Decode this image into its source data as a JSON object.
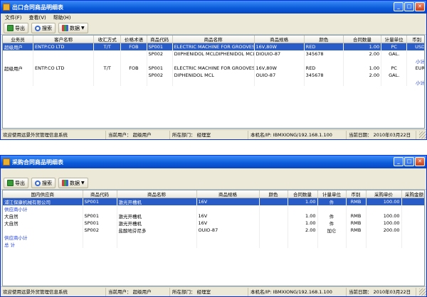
{
  "win1": {
    "title": "出口合同商品明细表",
    "menu": [
      "文件(F)",
      "查看(V)",
      "帮助(H)"
    ],
    "toolbar": {
      "export": "导出",
      "search": "搜索",
      "data": "数据"
    },
    "columns": [
      "业务员",
      "客户名称",
      "收汇方式",
      "价格术语",
      "商品代码",
      "商品名称",
      "商品规格",
      "颜色",
      "合同数量",
      "计量单位",
      "币别"
    ],
    "rows": [
      [
        "超级用户",
        "ENTP.CO LTD",
        "T/T",
        "FOB",
        "SP001",
        "ELECTRIC MACHINE FOR GROOVES WIT",
        "16V,80W",
        "RED",
        "1.00",
        "PC",
        "USD"
      ],
      [
        "",
        "",
        "",
        "",
        "SP002",
        "DIIPHENIDOL MCLDIPHENIDOL MCL",
        "DIOUIO-87",
        "345678",
        "2.00",
        "GAL.",
        ""
      ],
      [
        "",
        "",
        "",
        "",
        "",
        "",
        "",
        "",
        "",
        "",
        "小计"
      ],
      [
        "超级用户",
        "ENTP.CO LTD",
        "T/T",
        "FOB",
        "SP001",
        "ELECTRIC MACHINE FOR GROOVES WIT",
        "16V,80W",
        "RED",
        "1.00",
        "PC",
        "EUR"
      ],
      [
        "",
        "",
        "",
        "",
        "SP002",
        "DIPHENIDOL MCL",
        "OUIO-87",
        "345678",
        "2.00",
        "GAL.",
        ""
      ],
      [
        "",
        "",
        "",
        "",
        "",
        "",
        "",
        "",
        "",
        "",
        "小计"
      ]
    ],
    "status": {
      "app": "欢迎使用远景外贸管理信息系统",
      "user": "当前用户： 超级用户",
      "dept": "所在部门： 经理室",
      "host": "本机名/IP: IBMXIONG/192.168.1.100",
      "date": "当前日期： 2010年03月22日"
    }
  },
  "win2": {
    "title": "采购合同商品明细表",
    "toolbar": {
      "export": "导出",
      "search": "搜索",
      "data": "数据"
    },
    "columns": [
      "国内供应商",
      "商品代码",
      "商品名称",
      "商品规格",
      "颜色",
      "合同数量",
      "计量单位",
      "币别",
      "采购单价",
      "采购金额"
    ],
    "rows": [
      [
        "浦江保康机械有限公司",
        "SP001",
        "激光开槽机",
        "16V",
        "",
        "1.00",
        "件",
        "RMB",
        "100.00",
        ""
      ],
      [
        "供应商小计",
        "",
        "",
        "",
        "",
        "",
        "",
        "",
        "",
        ""
      ],
      [
        "大自然",
        "SP001",
        "激光开槽机",
        "16V",
        "",
        "1.00",
        "件",
        "RMB",
        "100.00",
        ""
      ],
      [
        "大自然",
        "SP001",
        "激光开槽机",
        "16V",
        "",
        "1.00",
        "件",
        "RMB",
        "100.00",
        ""
      ],
      [
        "",
        "SP002",
        "盐酸地芬尼多",
        "OUIO-87",
        "",
        "2.00",
        "加仑",
        "RMB",
        "200.00",
        ""
      ],
      [
        "供应商小计",
        "",
        "",
        "",
        "",
        "",
        "",
        "",
        "",
        ""
      ],
      [
        "总 计",
        "",
        "",
        "",
        "",
        "",
        "",
        "",
        "",
        ""
      ]
    ],
    "status": {
      "app": "欢迎使用远景外贸管理信息系统",
      "user": "当前用户： 超级用户",
      "dept": "所在部门： 经理室",
      "host": "本机名/IP: IBMXIONG/192.168.1.100",
      "date": "当前日期： 2010年03月22日"
    }
  },
  "colors": {
    "titlebar": "#0a5ad8",
    "selection": "#2a5cc8",
    "link": "#1c3ce0"
  }
}
